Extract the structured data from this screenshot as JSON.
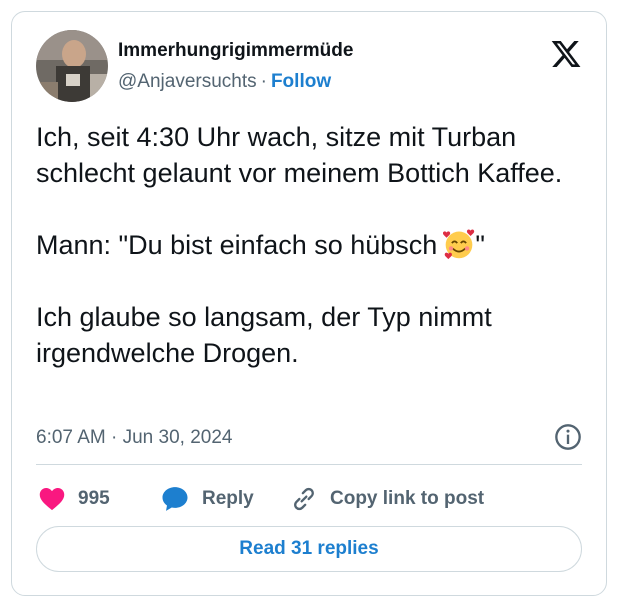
{
  "author": {
    "display_name": "Immerhungrigimmermüde",
    "handle": "@Anjaversuchts",
    "separator": "·",
    "follow_label": "Follow"
  },
  "tweet": {
    "line1": "Ich, seit 4:30 Uhr wach, sitze mit Turban schlecht gelaunt vor meinem Bottich Kaffee.",
    "line2_before": "Mann: \"Du bist einfach so hübsch",
    "line2_after": "\"",
    "line2_emoji": "smiling-face-with-hearts-icon",
    "line3": "Ich glaube so langsam, der Typ nimmt irgendwelche Drogen."
  },
  "timestamp": "6:07 AM · Jun 30, 2024",
  "actions": {
    "like_count": "995",
    "reply_label": "Reply",
    "copy_label": "Copy link to post"
  },
  "read_replies_label": "Read 31 replies",
  "colors": {
    "accent": "#1d7fcf",
    "like": "#f91880",
    "secondary_text": "#536471",
    "border": "#cfd9de"
  }
}
